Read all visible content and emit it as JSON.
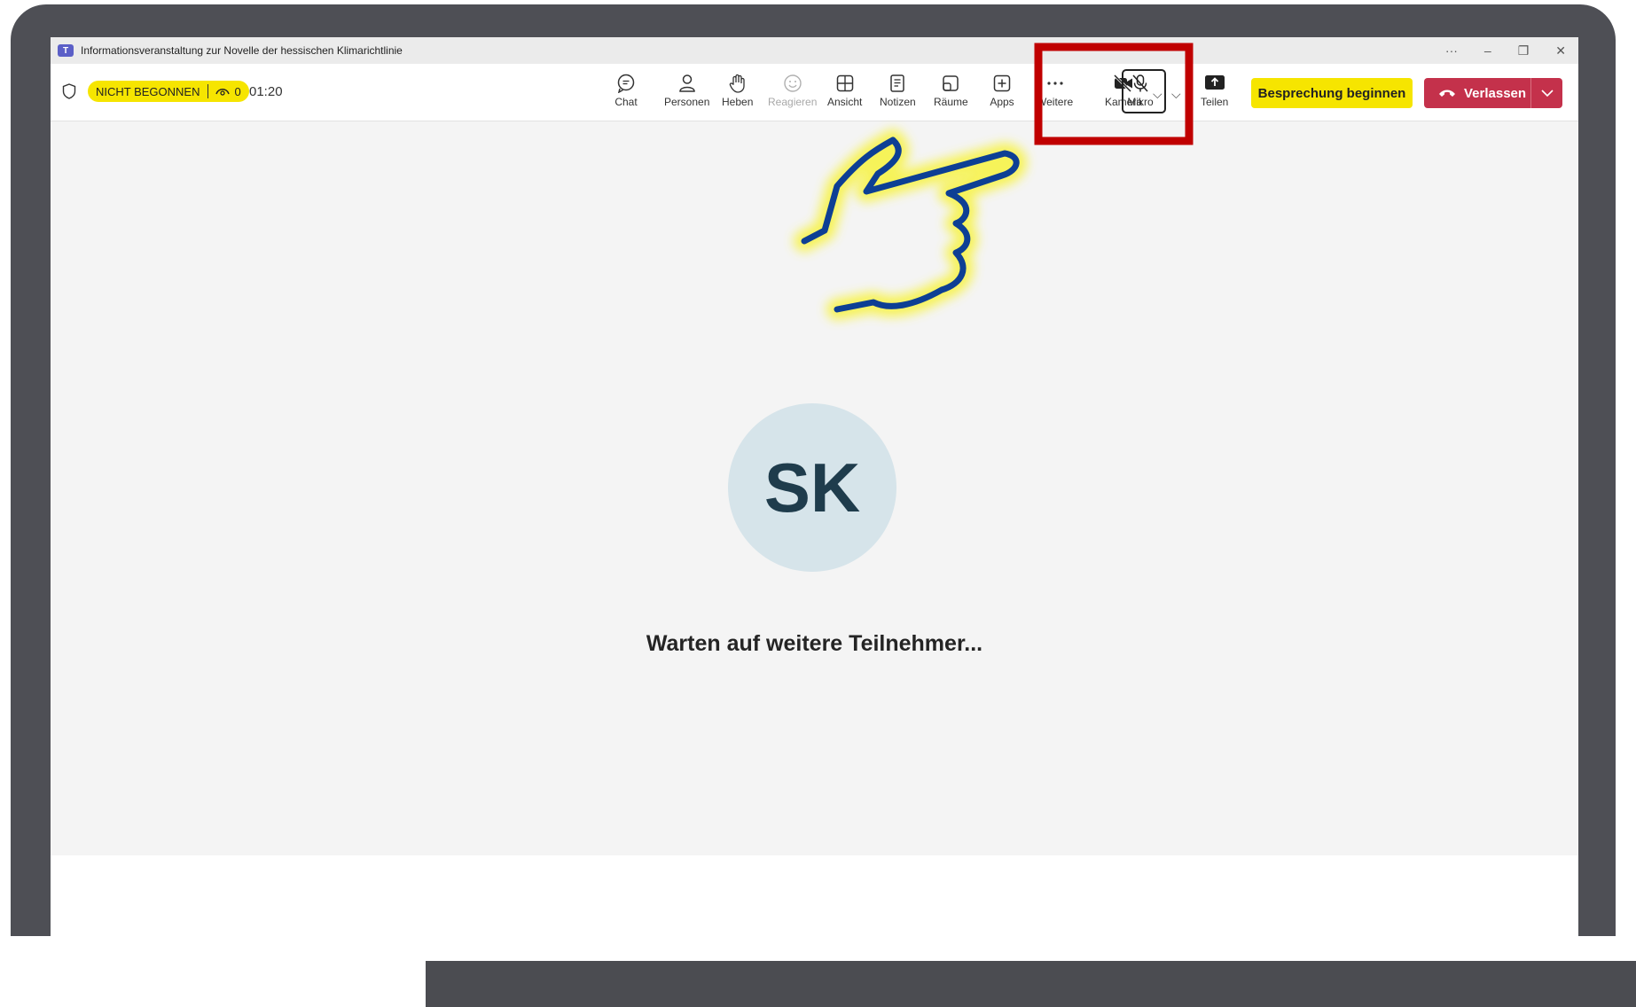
{
  "window": {
    "title": "Informationsveranstaltung zur Novelle der hessischen Klimarichtlinie",
    "controls": {
      "more": "···",
      "minimize": "–",
      "restore": "❐",
      "close": "✕"
    }
  },
  "toolbar": {
    "status_badge": "NICHT BEGONNEN",
    "viewer_count": "0",
    "timer": "01:20",
    "tools": {
      "chat": "Chat",
      "people": "Personen",
      "raise": "Heben",
      "react": "Reagieren",
      "view": "Ansicht",
      "notes": "Notizen",
      "rooms": "Räume",
      "apps": "Apps",
      "more": "Weitere",
      "camera": "Kamera",
      "mic": "Mikro",
      "share": "Teilen"
    },
    "start_meeting": "Besprechung beginnen",
    "leave": "Verlassen"
  },
  "stage": {
    "avatar_initials": "SK",
    "waiting_text": "Warten auf weitere Teilnehmer..."
  },
  "colors": {
    "accent_yellow": "#f6e500",
    "leave_red": "#c4314b",
    "highlight_box": "#c00000",
    "hand_stroke": "#0d3f94"
  }
}
